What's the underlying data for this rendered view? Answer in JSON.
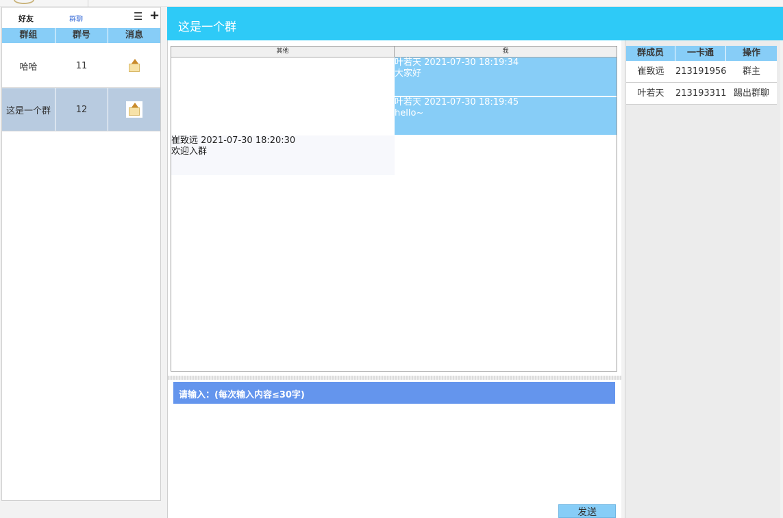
{
  "left_panel": {
    "tab_friends": "好友",
    "tab_groupchat": "群聊",
    "menu_icon": "☰",
    "add_icon": "+",
    "columns": [
      "群组",
      "群号",
      "消息"
    ],
    "groups": [
      {
        "name": "哈哈",
        "id": "11",
        "icon": "message-box-icon"
      },
      {
        "name": "这是一个群",
        "id": "12",
        "icon": "message-box-icon"
      }
    ]
  },
  "chat": {
    "title": "这是一个群",
    "col_other": "其他",
    "col_me": "我",
    "messages_me": [
      {
        "meta": "叶若天 2021-07-30 18:19:34",
        "text": "大家好"
      },
      {
        "meta": "叶若天 2021-07-30 18:19:45",
        "text": "hello~"
      }
    ],
    "messages_other": [
      {
        "meta": "崔致远 2021-07-30 18:20:30",
        "text": "欢迎入群"
      }
    ],
    "input_label": "请输入：(每次输入内容≤30字)",
    "send_label": "发送"
  },
  "members": {
    "columns": [
      "群成员",
      "一卡通",
      "操作"
    ],
    "rows": [
      {
        "name": "崔致远",
        "card": "213191956",
        "action": "群主"
      },
      {
        "name": "叶若天",
        "card": "213193311",
        "action": "踢出群聊"
      }
    ]
  },
  "colors": {
    "header_blue": "#2ecaf7",
    "table_header_blue": "#87cdf7",
    "input_bar_blue": "#6495ed",
    "selected_row": "#b8cbe0"
  }
}
